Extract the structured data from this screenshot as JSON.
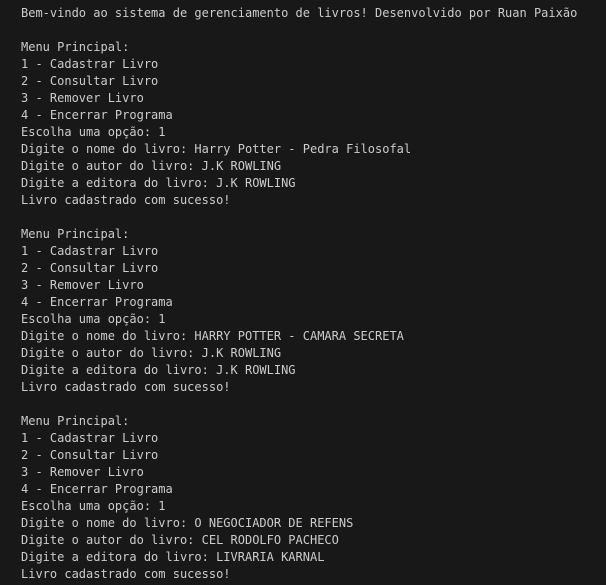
{
  "terminal": {
    "welcome": "Bem-vindo ao sistema de gerenciamento de livros! Desenvolvido por Ruan Paixão",
    "sessions": [
      {
        "menu_title": "Menu Principal:",
        "options": [
          "1 - Cadastrar Livro",
          "2 - Consultar Livro",
          "3 - Remover Livro",
          "4 - Encerrar Programa"
        ],
        "choice": "Escolha uma opção: 1",
        "name_prompt": "Digite o nome do livro: Harry Potter - Pedra Filosofal",
        "author_prompt": "Digite o autor do livro: J.K ROWLING",
        "publisher_prompt": "Digite a editora do livro: J.K ROWLING",
        "success": "Livro cadastrado com sucesso!"
      },
      {
        "menu_title": "Menu Principal:",
        "options": [
          "1 - Cadastrar Livro",
          "2 - Consultar Livro",
          "3 - Remover Livro",
          "4 - Encerrar Programa"
        ],
        "choice": "Escolha uma opção: 1",
        "name_prompt": "Digite o nome do livro: HARRY POTTER - CAMARA SECRETA",
        "author_prompt": "Digite o autor do livro: J.K ROWLING",
        "publisher_prompt": "Digite a editora do livro: J.K ROWLING",
        "success": "Livro cadastrado com sucesso!"
      },
      {
        "menu_title": "Menu Principal:",
        "options": [
          "1 - Cadastrar Livro",
          "2 - Consultar Livro",
          "3 - Remover Livro",
          "4 - Encerrar Programa"
        ],
        "choice": "Escolha uma opção: 1",
        "name_prompt": "Digite o nome do livro: O NEGOCIADOR DE REFENS",
        "author_prompt": "Digite o autor do livro: CEL RODOLFO PACHECO",
        "publisher_prompt": "Digite a editora do livro: LIVRARIA KARNAL",
        "success": "Livro cadastrado com sucesso!"
      }
    ]
  },
  "colors": {
    "background": "#181818",
    "text": "#cccccc"
  }
}
